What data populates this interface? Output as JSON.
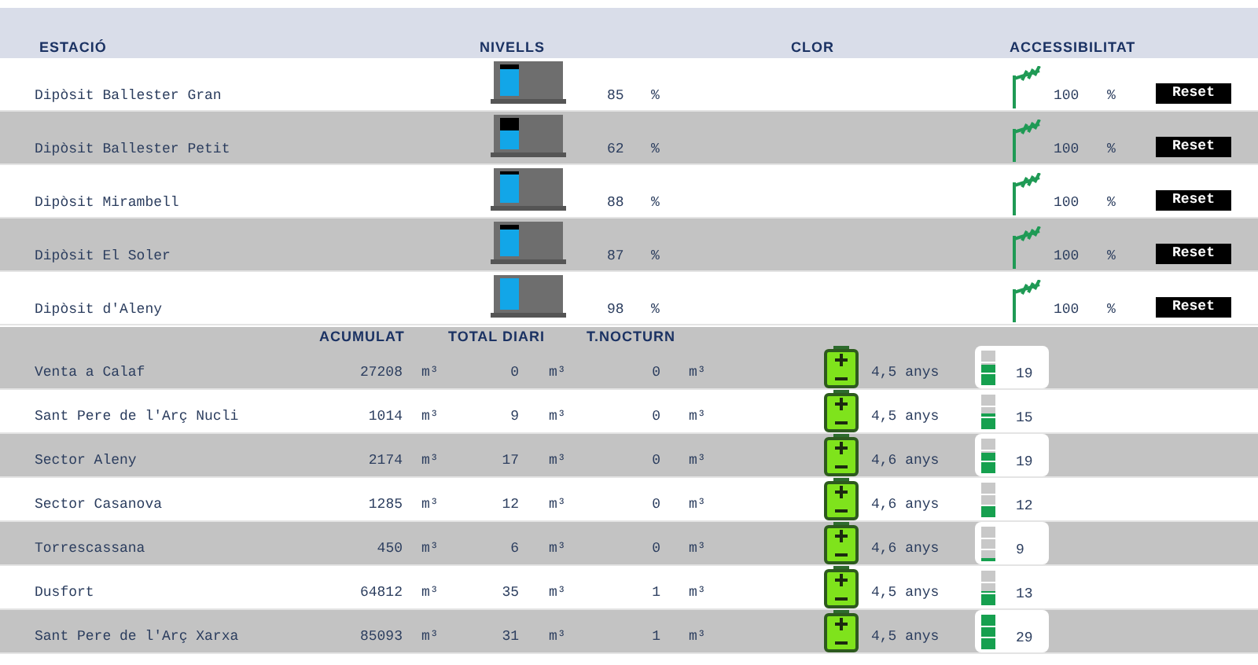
{
  "header": {
    "columns": [
      "ESTACIÓ",
      "NIVELLS",
      "CLOR",
      "ACCESSIBILITAT"
    ]
  },
  "stations": [
    {
      "name": "Dipòsit Ballester Gran",
      "level": 0.85,
      "value": "85",
      "unit": "%",
      "access": "100",
      "access_unit": "%",
      "button": "Reset"
    },
    {
      "name": "Dipòsit Ballester Petit",
      "level": 0.62,
      "value": "62",
      "unit": "%",
      "access": "100",
      "access_unit": "%",
      "button": "Reset"
    },
    {
      "name": "Dipòsit Mirambell",
      "level": 0.88,
      "value": "88",
      "unit": "%",
      "access": "100",
      "access_unit": "%",
      "button": "Reset"
    },
    {
      "name": "Dipòsit El Soler",
      "level": 0.87,
      "value": "87",
      "unit": "%",
      "access": "100",
      "access_unit": "%",
      "button": "Reset"
    },
    {
      "name": "Dipòsit d'Aleny",
      "level": 0.98,
      "value": "98",
      "unit": "%",
      "access": "100",
      "access_unit": "%",
      "button": "Reset"
    }
  ],
  "meters_header": {
    "columns": [
      "ACUMULAT",
      "TOTAL DIARI",
      "T.NOCTURN"
    ]
  },
  "meters": [
    {
      "name": "Venta a Calaf",
      "acumulat": "27208",
      "acumulat_unit": "m³",
      "total": "0",
      "total_unit": "m³",
      "nocturn": "0",
      "nocturn_unit": "m³",
      "battery": "4,5 anys",
      "signal": "19",
      "level": 0.6
    },
    {
      "name": "Sant Pere de l'Arç Nucli",
      "acumulat": "1014",
      "acumulat_unit": "m³",
      "total": "9",
      "total_unit": "m³",
      "nocturn": "0",
      "nocturn_unit": "m³",
      "battery": "4,5 anys",
      "signal": "15",
      "level": 0.45
    },
    {
      "name": "Sector Aleny",
      "acumulat": "2174",
      "acumulat_unit": "m³",
      "total": "17",
      "total_unit": "m³",
      "nocturn": "0",
      "nocturn_unit": "m³",
      "battery": "4,6 anys",
      "signal": "19",
      "level": 0.6
    },
    {
      "name": "Sector Casanova",
      "acumulat": "1285",
      "acumulat_unit": "m³",
      "total": "12",
      "total_unit": "m³",
      "nocturn": "0",
      "nocturn_unit": "m³",
      "battery": "4,6 anys",
      "signal": "12",
      "level": 0.33
    },
    {
      "name": "Torrescassana",
      "acumulat": "450",
      "acumulat_unit": "m³",
      "total": "6",
      "total_unit": "m³",
      "nocturn": "0",
      "nocturn_unit": "m³",
      "battery": "4,6 anys",
      "signal": "9",
      "level": 0.1
    },
    {
      "name": "Dusfort",
      "acumulat": "64812",
      "acumulat_unit": "m³",
      "total": "35",
      "total_unit": "m³",
      "nocturn": "1",
      "nocturn_unit": "m³",
      "battery": "4,5 anys",
      "signal": "13",
      "level": 0.4
    },
    {
      "name": "Sant Pere de l'Arç Xarxa",
      "acumulat": "85093",
      "acumulat_unit": "m³",
      "total": "31",
      "total_unit": "m³",
      "nocturn": "1",
      "nocturn_unit": "m³",
      "battery": "4,5 anys",
      "signal": "29",
      "level": 1.0
    }
  ]
}
